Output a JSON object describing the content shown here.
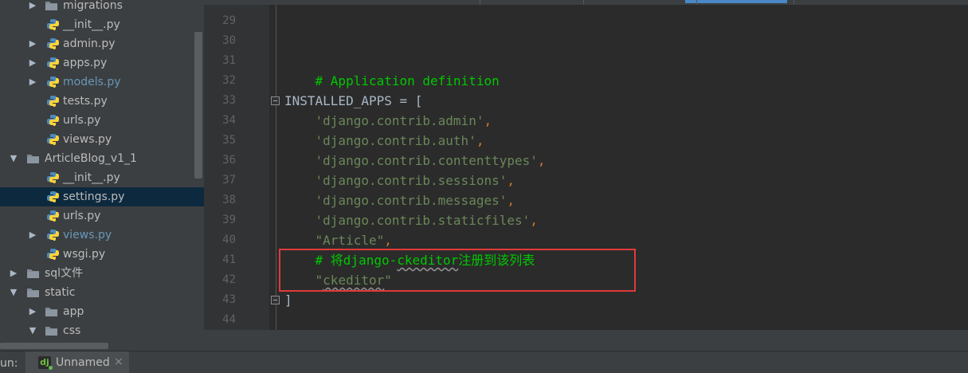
{
  "project_tree": {
    "items": [
      {
        "label": "migrations",
        "kind": "folder",
        "expanded": false
      },
      {
        "label": "__init__.py",
        "kind": "python"
      },
      {
        "label": "admin.py",
        "kind": "python",
        "expandable": true
      },
      {
        "label": "apps.py",
        "kind": "python",
        "expandable": true
      },
      {
        "label": "models.py",
        "kind": "python",
        "expandable": true,
        "modified": true
      },
      {
        "label": "tests.py",
        "kind": "python"
      },
      {
        "label": "urls.py",
        "kind": "python"
      },
      {
        "label": "views.py",
        "kind": "python"
      },
      {
        "label": "ArticleBlog_v1_1",
        "kind": "folder",
        "expanded": true
      },
      {
        "label": "__init__.py",
        "kind": "python"
      },
      {
        "label": "settings.py",
        "kind": "python",
        "selected": true
      },
      {
        "label": "urls.py",
        "kind": "python"
      },
      {
        "label": "views.py",
        "kind": "python",
        "expandable": true,
        "modified": true
      },
      {
        "label": "wsgi.py",
        "kind": "python"
      },
      {
        "label": "sql文件",
        "kind": "folder",
        "expanded": false
      },
      {
        "label": "static",
        "kind": "folder",
        "expanded": true
      },
      {
        "label": "app",
        "kind": "folder",
        "expanded": false
      },
      {
        "label": "css",
        "kind": "folder",
        "expanded": true
      }
    ]
  },
  "editor": {
    "line_numbers": [
      "29",
      "30",
      "31",
      "32",
      "33",
      "34",
      "35",
      "36",
      "37",
      "38",
      "39",
      "40",
      "41",
      "42",
      "43",
      "44"
    ],
    "code": {
      "l31": "# Application definition",
      "l33_name": "INSTALLED_APPS",
      "l33_rest": " = [",
      "l34": "'django.contrib.admin'",
      "l35": "'django.contrib.auth'",
      "l36": "'django.contrib.contenttypes'",
      "l37": "'django.contrib.sessions'",
      "l38": "'django.contrib.messages'",
      "l39": "'django.contrib.staticfiles'",
      "l40": "\"Article\"",
      "l41_prefix": "# 将django-",
      "l41_word": "ckeditor",
      "l41_suffix": "注册到该列表",
      "l42_open": "\"",
      "l42_word": "ckeditor",
      "l42_close": "\"",
      "l43": "]",
      "comma": ","
    }
  },
  "run_bar": {
    "label": "un:",
    "tab_icon": "dj",
    "tab_label": "Unnamed",
    "close": "×"
  },
  "colors": {
    "comment": "#00c800",
    "string": "#6a8759",
    "highlight_box": "#e03a3a",
    "selected_row": "#0d293e"
  }
}
